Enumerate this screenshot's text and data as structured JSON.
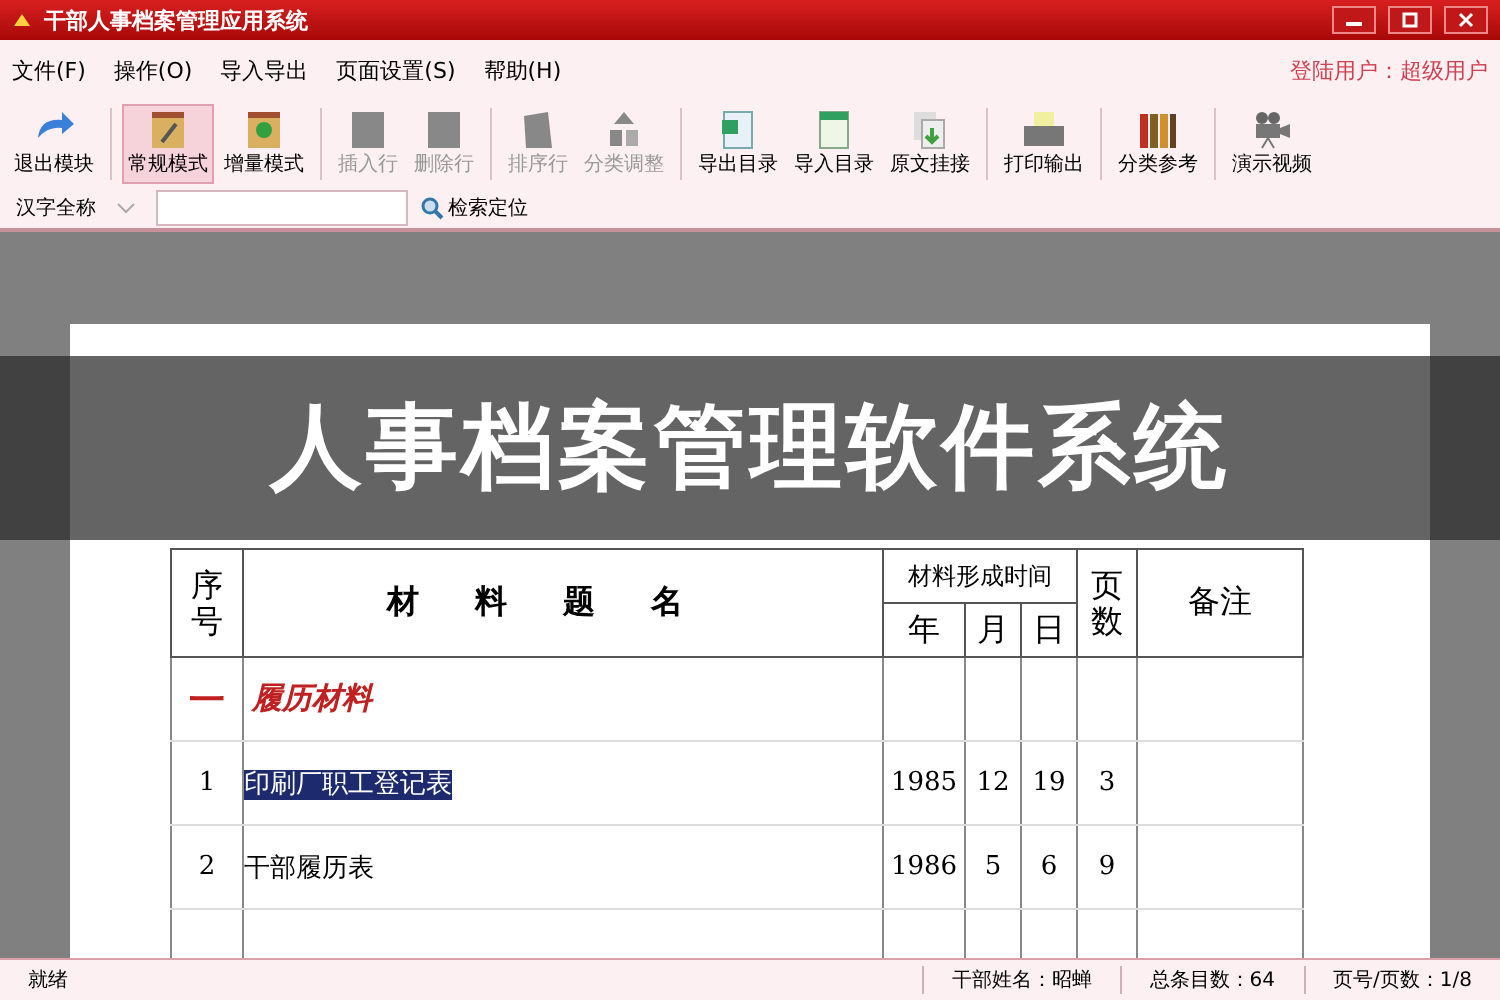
{
  "window": {
    "title": "干部人事档案管理应用系统"
  },
  "menu": [
    "文件(F)",
    "操作(O)",
    "导入导出",
    "页面设置(S)",
    "帮助(H)"
  ],
  "login": "登陆用户：超级用户",
  "toolbar": [
    {
      "label": "退出模块",
      "selected": false,
      "disabled": false
    },
    {
      "label": "常规模式",
      "selected": true,
      "disabled": false
    },
    {
      "label": "增量模式",
      "selected": false,
      "disabled": false
    },
    {
      "label": "插入行",
      "selected": false,
      "disabled": true
    },
    {
      "label": "删除行",
      "selected": false,
      "disabled": true
    },
    {
      "label": "排序行",
      "selected": false,
      "disabled": true
    },
    {
      "label": "分类调整",
      "selected": false,
      "disabled": true
    },
    {
      "label": "导出目录",
      "selected": false,
      "disabled": false
    },
    {
      "label": "导入目录",
      "selected": false,
      "disabled": false
    },
    {
      "label": "原文挂接",
      "selected": false,
      "disabled": false
    },
    {
      "label": "打印输出",
      "selected": false,
      "disabled": false
    },
    {
      "label": "分类参考",
      "selected": false,
      "disabled": false
    },
    {
      "label": "演示视频",
      "selected": false,
      "disabled": false
    }
  ],
  "search": {
    "field_label": "汉字全称",
    "button": "检索定位"
  },
  "banner": "人事档案管理软件系统",
  "table": {
    "columns": {
      "no": "序号",
      "title": "材料题名",
      "time": "材料形成时间",
      "year": "年",
      "month": "月",
      "day": "日",
      "pages": "页数",
      "note": "备注"
    },
    "rows": [
      {
        "kind": "section",
        "no": "一",
        "title": "履历材料"
      },
      {
        "kind": "item",
        "no": "1",
        "title": "印刷厂职工登记表",
        "year": "1985",
        "month": "12",
        "day": "19",
        "pages": "3",
        "selected": true
      },
      {
        "kind": "item",
        "no": "2",
        "title": "干部履历表",
        "year": "1986",
        "month": "5",
        "day": "6",
        "pages": "9",
        "selected": false
      },
      {
        "kind": "cut"
      }
    ]
  },
  "status_bar": {
    "state": "就绪",
    "cadre": "干部姓名：昭蝉",
    "total": "总条目数：64",
    "page": "页号/页数：1/8"
  }
}
